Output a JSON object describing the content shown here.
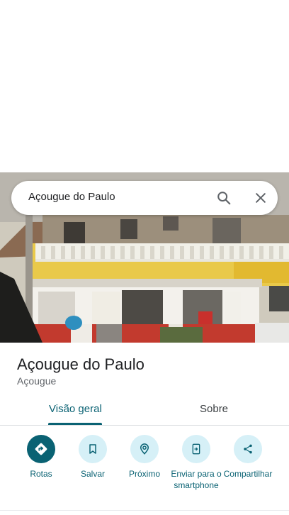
{
  "search": {
    "query": "Açougue do Paulo"
  },
  "place": {
    "name": "Açougue do Paulo",
    "category": "Açougue"
  },
  "tabs": [
    {
      "label": "Visão geral",
      "selected": true
    },
    {
      "label": "Sobre",
      "selected": false
    }
  ],
  "actions": [
    {
      "label": "Rotas",
      "icon": "directions-icon",
      "primary": true
    },
    {
      "label": "Salvar",
      "icon": "bookmark-icon",
      "primary": false
    },
    {
      "label": "Próximo",
      "icon": "nearby-icon",
      "primary": false
    },
    {
      "label": "Enviar para o smartphone",
      "icon": "send-to-phone-icon",
      "primary": false
    },
    {
      "label": "Compartilhar",
      "icon": "share-icon",
      "primary": false
    }
  ],
  "colors": {
    "accent": "#0a6273",
    "action_bg": "#d6f0f7",
    "building_yellow": "#e9c94a"
  }
}
